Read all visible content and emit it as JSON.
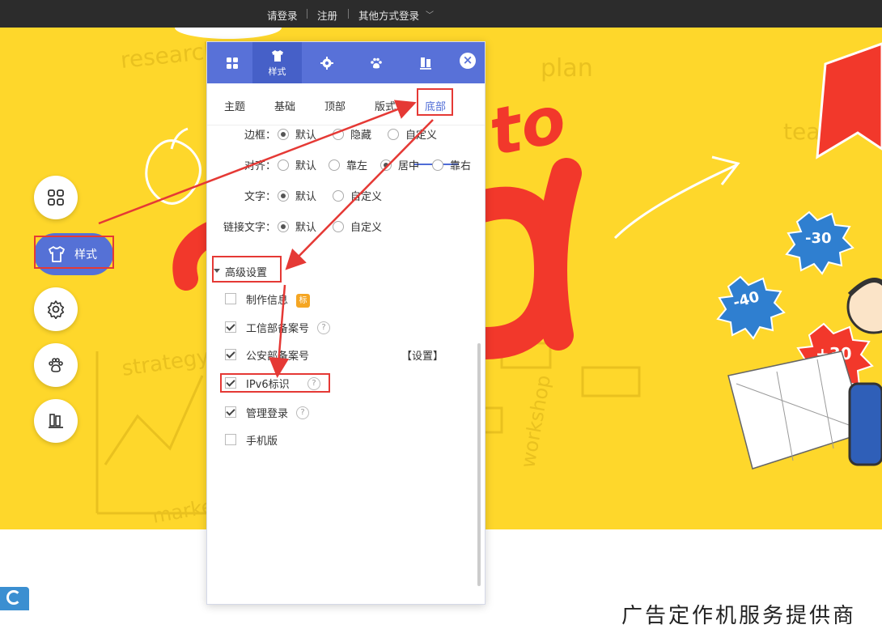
{
  "topbar": {
    "login": "请登录",
    "register": "注册",
    "other_login": "其他方式登录"
  },
  "hero": {
    "doodles": [
      "research",
      "plan",
      "strategy",
      "workshop",
      "market",
      "teach"
    ],
    "headline_fragment": "to",
    "stickers": [
      "-30",
      "-40",
      "+30"
    ]
  },
  "side_toolbar": {
    "style_label": "样式"
  },
  "panel": {
    "tabs": [
      {
        "icon": "grid-icon",
        "label": ""
      },
      {
        "icon": "shirt-icon",
        "label": "样式"
      },
      {
        "icon": "gear-icon",
        "label": ""
      },
      {
        "icon": "paw-icon",
        "label": ""
      },
      {
        "icon": "book-icon",
        "label": ""
      }
    ],
    "close_label": "×",
    "subtabs": [
      "主题",
      "基础",
      "顶部",
      "版式",
      "底部"
    ],
    "active_subtab": "底部",
    "options": {
      "border": {
        "label": "边框：",
        "choices": [
          "默认",
          "隐藏",
          "自定义"
        ],
        "selected": "默认"
      },
      "align": {
        "label": "对齐：",
        "choices": [
          "默认",
          "靠左",
          "居中",
          "靠右"
        ],
        "selected": "居中"
      },
      "text": {
        "label": "文字：",
        "choices": [
          "默认",
          "自定义"
        ],
        "selected": "默认"
      },
      "link_text": {
        "label": "链接文字：",
        "choices": [
          "默认",
          "自定义"
        ],
        "selected": "默认"
      }
    },
    "advanced": {
      "title": "高级设置",
      "items": [
        {
          "label": "制作信息",
          "checked": false,
          "badge": "标"
        },
        {
          "label": "工信部备案号",
          "checked": true,
          "help": "?"
        },
        {
          "label": "公安部备案号",
          "checked": true,
          "link": "【设置】"
        },
        {
          "label": "IPv6标识",
          "checked": true,
          "help": "?"
        },
        {
          "label": "管理登录",
          "checked": true,
          "help": "?"
        },
        {
          "label": "手机版",
          "checked": false
        }
      ]
    }
  },
  "below": {
    "teaser": "广告定作机服务提供商"
  },
  "colors": {
    "accent": "#5871d8",
    "hero_bg": "#fed72b",
    "annotation": "#e53935"
  }
}
